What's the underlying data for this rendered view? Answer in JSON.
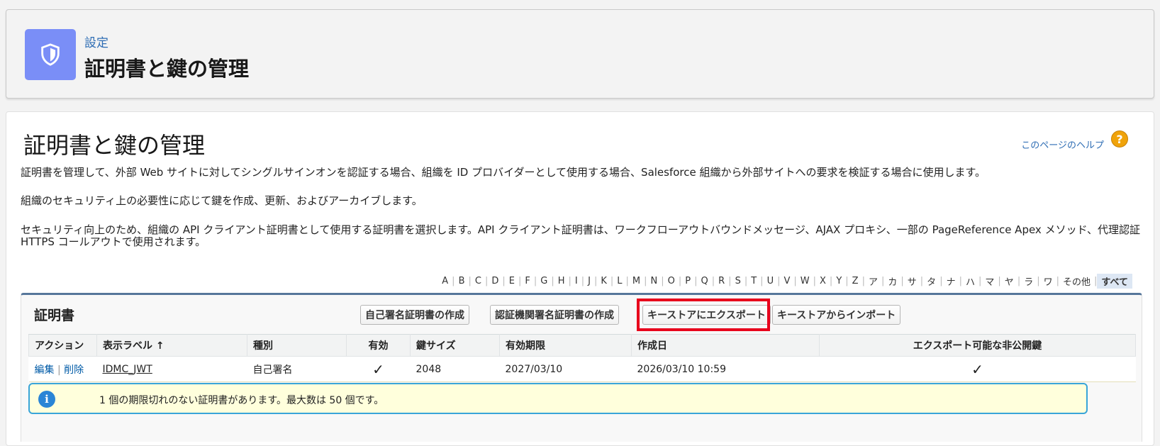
{
  "header": {
    "crumb": "設定",
    "title": "証明書と鍵の管理",
    "icon": "shield-icon"
  },
  "main": {
    "title": "証明書と鍵の管理",
    "help_link": "このページのヘルプ",
    "help_icon": "?",
    "descriptions": [
      "証明書を管理して、外部 Web サイトに対してシングルサインオンを認証する場合、組織を ID プロバイダーとして使用する場合、Salesforce 組織から外部サイトへの要求を検証する場合に使用します。",
      "組織のセキュリティ上の必要性に応じて鍵を作成、更新、およびアーカイブします。",
      "セキュリティ向上のため、組織の API クライアント証明書として使用する証明書を選択します。API クライアント証明書は、ワークフローアウトバウンドメッセージ、AJAX プロキシ、一部の PageReference Apex メソッド、代理認証 HTTPS コールアウトで使用されます。"
    ]
  },
  "alpha_filter": {
    "letters": [
      "A",
      "B",
      "C",
      "D",
      "E",
      "F",
      "G",
      "H",
      "I",
      "J",
      "K",
      "L",
      "M",
      "N",
      "O",
      "P",
      "Q",
      "R",
      "S",
      "T",
      "U",
      "V",
      "W",
      "X",
      "Y",
      "Z",
      "ア",
      "カ",
      "サ",
      "タ",
      "ナ",
      "ハ",
      "マ",
      "ヤ",
      "ラ",
      "ワ",
      "その他"
    ],
    "active": "すべて"
  },
  "certificates": {
    "title": "証明書",
    "buttons": {
      "self_signed": "自己署名証明書の作成",
      "ca_signed": "認証機関署名証明書の作成",
      "export_keystore": "キーストアにエクスポート",
      "import_keystore": "キーストアからインポート"
    },
    "columns": [
      "アクション",
      "表示ラベル ↑",
      "種別",
      "有効",
      "鍵サイズ",
      "有効期限",
      "作成日",
      "エクスポート可能な非公開鍵"
    ],
    "rows": [
      {
        "edit": "編集",
        "sep": "|",
        "delete": "削除",
        "label": "IDMC_JWT",
        "type": "自己署名",
        "active": "✓",
        "key_size": "2048",
        "expires": "2027/03/10",
        "created": "2026/03/10 10:59",
        "exportable": "✓"
      }
    ],
    "info_icon": "i",
    "info_message": "1 個の期限切れのない証明書があります。最大数は 50 個です。"
  },
  "colors": {
    "header_icon_bg": "#7a8ef7",
    "link": "#015ba7",
    "highlight": "#e8001c",
    "info_border": "#39a5d8",
    "info_bg": "#ffffdc"
  }
}
